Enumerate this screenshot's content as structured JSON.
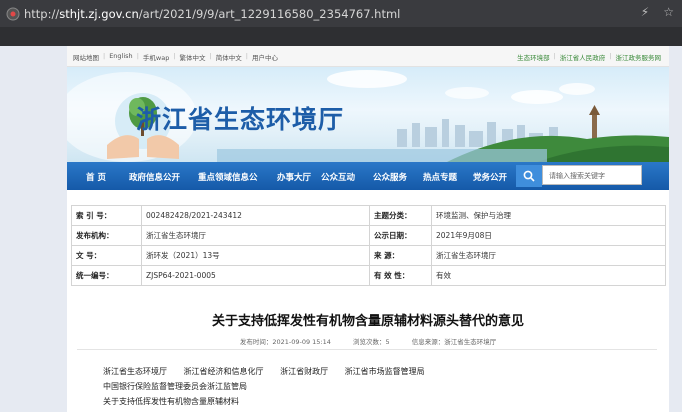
{
  "browser": {
    "url_prefix": "http://",
    "url_host": "sthjt.zj.gov.cn",
    "url_path": "/art/2021/9/9/art_1229116580_2354767.html",
    "icons": [
      "translate-icon",
      "favorite-icon"
    ]
  },
  "topbar": {
    "left_links": [
      "网站地图",
      "English",
      "手机wap",
      "繁体中文",
      "简体中文",
      "用户中心"
    ],
    "right_links": [
      "生态环境部",
      "浙江省人民政府",
      "浙江政务服务网"
    ]
  },
  "banner": {
    "title": "浙江省生态环境厅"
  },
  "nav": {
    "items": [
      "首 页",
      "政府信息公开",
      "重点领域信息公",
      "办事大厅",
      "公众互动",
      "公众服务",
      "热点专题",
      "党务公开"
    ],
    "search_placeholder": "请输入搜索关键字"
  },
  "meta": {
    "rows": [
      {
        "l1": "索 引 号：",
        "v1": "002482428/2021-243412",
        "l2": "主题分类：",
        "v2": "环境监测、保护与治理"
      },
      {
        "l1": "发布机构：",
        "v1": "浙江省生态环境厅",
        "l2": "公示日期：",
        "v2": "2021年9月08日"
      },
      {
        "l1": "文      号：",
        "v1": "浙环发（2021）13号",
        "l2": "来      源：",
        "v2": "浙江省生态环境厅"
      },
      {
        "l1": "统一编号：",
        "v1": "ZJSP64-2021-0005",
        "l2": "有 效 性：",
        "v2": "有效"
      }
    ]
  },
  "document": {
    "title": "关于支持低挥发性有机物含量原辅材料源头替代的意见",
    "publish_time": "发布时间：2021-09-09 15:14",
    "views": "浏览次数：5",
    "source": "信息来源：浙江省生态环境厅",
    "body_lines": [
      [
        "浙江省生态环境厅",
        "浙江省经济和信息化厅",
        "浙江省财政厅",
        "浙江省市场监督管理局"
      ],
      [
        "中国银行保险监督管理委员会浙江监管局"
      ],
      [
        "关于支持低挥发性有机物含量原辅材料"
      ]
    ]
  },
  "colors": {
    "nav_bg": "#1f6bb8",
    "title_blue": "#1d5da8",
    "browser_bar": "#3a3b3f"
  }
}
